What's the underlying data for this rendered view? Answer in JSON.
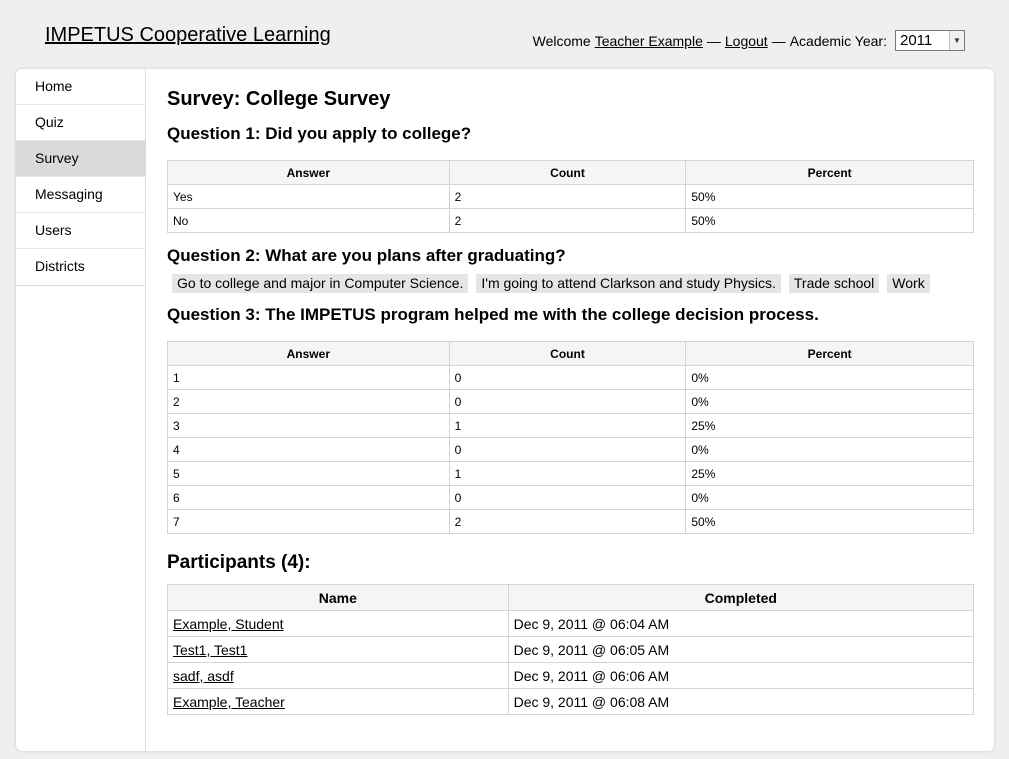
{
  "header": {
    "site_title": "IMPETUS Cooperative Learning",
    "welcome_text": "Welcome",
    "user_name": "Teacher Example",
    "separator1": "—",
    "logout_label": "Logout",
    "separator2": "—",
    "year_label": "Academic Year:",
    "year_value": "2011"
  },
  "sidebar": {
    "items": [
      {
        "label": "Home"
      },
      {
        "label": "Quiz"
      },
      {
        "label": "Survey"
      },
      {
        "label": "Messaging"
      },
      {
        "label": "Users"
      },
      {
        "label": "Districts"
      }
    ],
    "active": "Survey"
  },
  "survey": {
    "title": "Survey: College Survey",
    "table_headers": {
      "answer": "Answer",
      "count": "Count",
      "percent": "Percent"
    },
    "q1": {
      "title": "Question 1: Did you apply to college?",
      "rows": [
        {
          "answer": "Yes",
          "count": "2",
          "percent": "50%"
        },
        {
          "answer": "No",
          "count": "2",
          "percent": "50%"
        }
      ]
    },
    "q2": {
      "title": "Question 2: What are you plans after graduating?",
      "answers": [
        "Go to college and major in Computer Science.",
        "I'm going to attend Clarkson and study Physics.",
        "Trade school",
        "Work"
      ]
    },
    "q3": {
      "title": "Question 3: The IMPETUS program helped me with the college decision process.",
      "rows": [
        {
          "answer": "1",
          "count": "0",
          "percent": "0%"
        },
        {
          "answer": "2",
          "count": "0",
          "percent": "0%"
        },
        {
          "answer": "3",
          "count": "1",
          "percent": "25%"
        },
        {
          "answer": "4",
          "count": "0",
          "percent": "0%"
        },
        {
          "answer": "5",
          "count": "1",
          "percent": "25%"
        },
        {
          "answer": "6",
          "count": "0",
          "percent": "0%"
        },
        {
          "answer": "7",
          "count": "2",
          "percent": "50%"
        }
      ]
    }
  },
  "participants": {
    "title": "Participants (4):",
    "headers": {
      "name": "Name",
      "completed": "Completed"
    },
    "rows": [
      {
        "name": "Example, Student",
        "completed": "Dec 9, 2011 @ 06:04 AM"
      },
      {
        "name": "Test1, Test1",
        "completed": "Dec 9, 2011 @ 06:05 AM"
      },
      {
        "name": "sadf, asdf",
        "completed": "Dec 9, 2011 @ 06:06 AM"
      },
      {
        "name": "Example, Teacher",
        "completed": "Dec 9, 2011 @ 06:08 AM"
      }
    ]
  }
}
